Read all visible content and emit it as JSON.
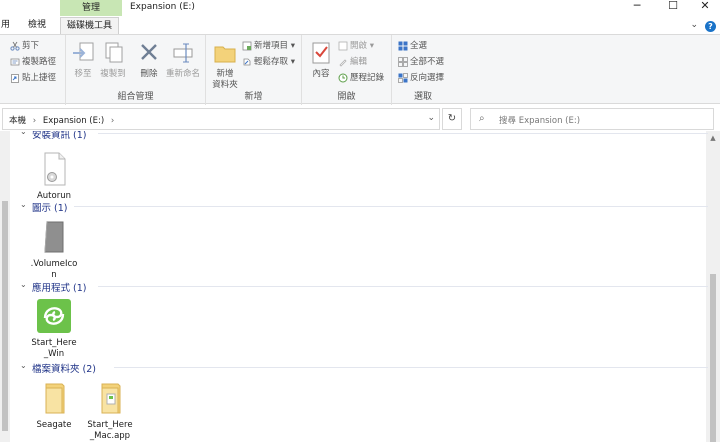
{
  "window": {
    "title": "Expansion (E:)",
    "minimize": "─",
    "maximize": "☐",
    "close": "✕"
  },
  "tabs": {
    "context_group": "管理",
    "items": [
      "用",
      "檢視",
      "磁碟機工具"
    ]
  },
  "ribbon": {
    "clipboard": {
      "cut": "剪下",
      "copy_path": "複製路徑",
      "paste_shortcut": "貼上捷徑"
    },
    "organize": {
      "label": "組合管理",
      "move_to": "移至",
      "copy_to": "複製到",
      "delete": "刪除",
      "rename": "重新命名"
    },
    "new": {
      "label": "新增",
      "new_folder_line1": "新增",
      "new_folder_line2": "資料夾",
      "new_item": "新增項目",
      "easy_access": "輕鬆存取"
    },
    "open": {
      "label": "開啟",
      "properties": "內容",
      "open": "開啟",
      "edit": "編輯",
      "history": "歷程記錄"
    },
    "select": {
      "label": "選取",
      "select_all": "全選",
      "select_none": "全部不選",
      "invert": "反向選擇"
    }
  },
  "address": {
    "root": "本機",
    "drive": "Expansion (E:)",
    "search_placeholder": "搜尋 Expansion (E:)"
  },
  "groups": [
    {
      "title": "安裝資訊 (1)",
      "files": [
        "Autorun"
      ]
    },
    {
      "title": "圖示 (1)",
      "files": [
        ".VolumeIcon"
      ]
    },
    {
      "title": "應用程式 (1)",
      "files": [
        "Start_Here_Win"
      ]
    },
    {
      "title": "檔案資料夾 (2)",
      "files": [
        "Seagate",
        "Start_Here_Mac.app"
      ]
    }
  ],
  "colors": {
    "context_tab": "#c8e6b4",
    "group_title": "#1e3287",
    "seagate_green": "#6cc24a",
    "folder_yellow": "#f3d27a"
  }
}
